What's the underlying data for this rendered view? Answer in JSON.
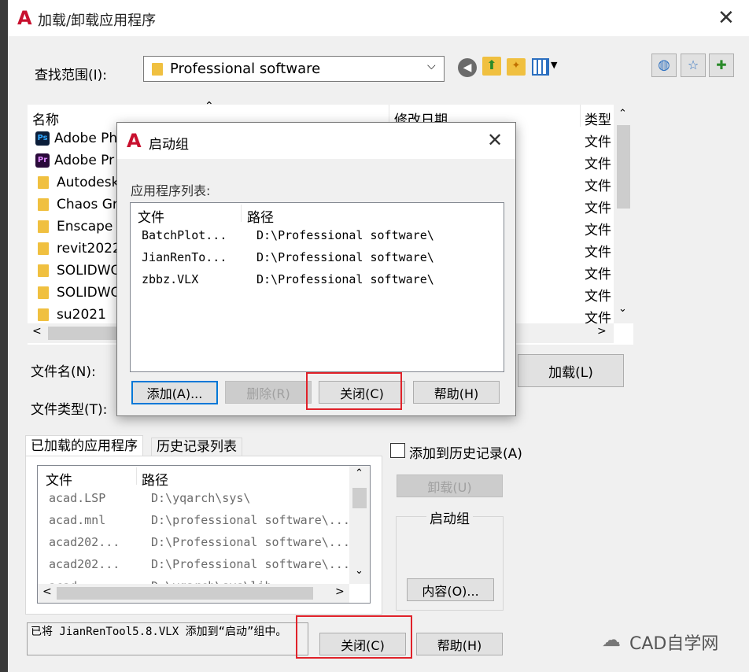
{
  "main_dialog": {
    "title": "加载/卸载应用程序",
    "lookin_label": "查找范围(I):",
    "lookin_value": "Professional software",
    "file_list": {
      "col_name": "名称",
      "col_date": "修改日期",
      "col_type": "类型",
      "items": [
        {
          "icon": "photoshop-icon",
          "badge": "Ps",
          "name": "Adobe Ph",
          "type": "文件"
        },
        {
          "icon": "premiere-icon",
          "badge": "Pr",
          "name": "Adobe Pr",
          "type": "文件"
        },
        {
          "icon": "folder-icon",
          "name": "Autodesk",
          "type": "文件"
        },
        {
          "icon": "folder-icon",
          "name": "Chaos Gr",
          "type": "文件"
        },
        {
          "icon": "folder-icon",
          "name": "Enscape",
          "type": "文件"
        },
        {
          "icon": "folder-icon",
          "name": "revit2022",
          "type": "文件"
        },
        {
          "icon": "folder-icon",
          "name": "SOLIDWO",
          "type": "文件"
        },
        {
          "icon": "folder-icon",
          "name": "SOLIDWO",
          "type": "文件"
        },
        {
          "icon": "folder-icon",
          "name": "su2021",
          "type": "文件"
        }
      ]
    },
    "filename_label": "文件名(N):",
    "filetype_label": "文件类型(T):",
    "load_button": "加载(L)",
    "tabs": [
      "已加载的应用程序",
      "历史记录列表"
    ],
    "loaded_list": {
      "col_file": "文件",
      "col_path": "路径",
      "rows": [
        {
          "file": "acad.LSP",
          "path": "D:\\yqarch\\sys\\"
        },
        {
          "file": "acad.mnl",
          "path": "D:\\professional software\\..."
        },
        {
          "file": "acad202...",
          "path": "D:\\Professional software\\..."
        },
        {
          "file": "acad202...",
          "path": "D:\\Professional software\\..."
        },
        {
          "file": "acad...",
          "path": "D:\\yqarch\\sys\\lib..."
        }
      ]
    },
    "add_history_label": "添加到历史记录(A)",
    "unload_button": "卸载(U)",
    "startup_group_label": "启动组",
    "contents_button": "内容(O)...",
    "status_message": "已将 JianRenTool5.8.VLX 添加到“启动”组中。",
    "close_button": "关闭(C)",
    "help_button": "帮助(H)",
    "watermark": "CAD自学网"
  },
  "startup_dialog": {
    "title": "启动组",
    "list_label": "应用程序列表:",
    "col_file": "文件",
    "col_path": "路径",
    "rows": [
      {
        "file": "BatchPlot...",
        "path": "D:\\Professional software\\"
      },
      {
        "file": "JianRenTo...",
        "path": "D:\\Professional software\\"
      },
      {
        "file": "zbbz.VLX",
        "path": "D:\\Professional software\\"
      }
    ],
    "add_button": "添加(A)...",
    "remove_button": "删除(R)",
    "close_button": "关闭(C)",
    "help_button": "帮助(H)"
  },
  "colors": {
    "accent_red": "#e0222a",
    "autocad_red": "#c8102e",
    "folder": "#f0c040"
  }
}
